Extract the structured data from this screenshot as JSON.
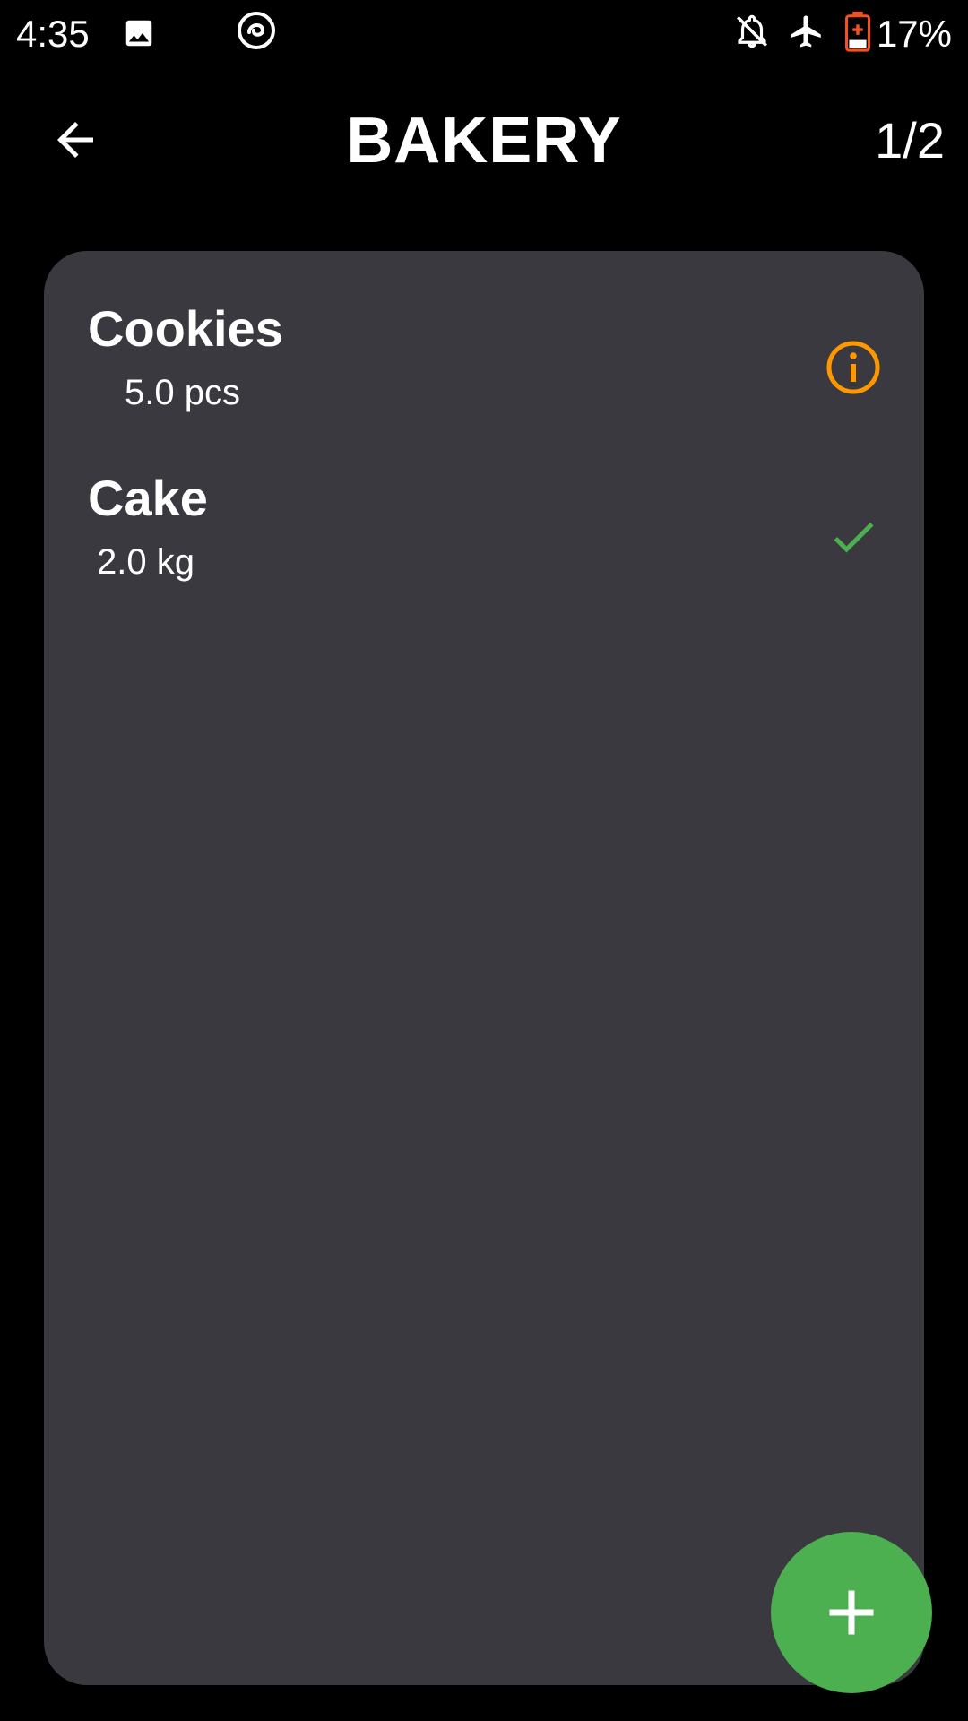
{
  "status_bar": {
    "time": "4:35",
    "battery_percent": "17%",
    "icons": [
      "image-icon",
      "app-spiral-icon",
      "notifications-off-icon",
      "airplane-mode-icon",
      "battery-saver-icon"
    ]
  },
  "app_bar": {
    "title": "BAKERY",
    "page_counter": "1/2",
    "back_icon": "arrow-back-icon"
  },
  "items": [
    {
      "name": "Cookies",
      "quantity": "5.0 pcs",
      "status_icon": "info-icon",
      "status_color": "#ff9800"
    },
    {
      "name": "Cake",
      "quantity": "2.0 kg",
      "status_icon": "check-icon",
      "status_color": "#4caf50"
    }
  ],
  "fab": {
    "icon": "plus-icon",
    "color": "#4caf50"
  },
  "colors": {
    "background": "#000000",
    "card": "#3a393f",
    "accent_orange": "#ff9800",
    "accent_green": "#4caf50",
    "battery_red": "#f4511e"
  }
}
